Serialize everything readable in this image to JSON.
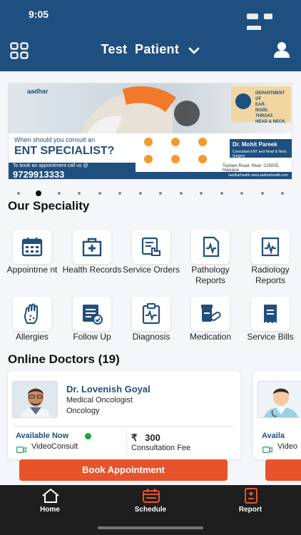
{
  "status_bar": {
    "time": "9:05"
  },
  "header": {
    "patient_name": "Test  Patient"
  },
  "banner": {
    "brand": "aadhar",
    "question": "When should you consult an",
    "title": "ENT SPECIALIST?",
    "call_note": "To book an appointment call us @",
    "phone": "9729913333",
    "department": "DEPARTMENT OF\nEAR.\nNOSE.\nTHROAT.\nHEAD & NECK.",
    "doctor_name": "Dr. Mohit Pareek",
    "doctor_sub": "Consultant ENT and Head & Neck Surgery",
    "address": "Tosham Road, Hisar -125005, Haryana",
    "footer": "/aadharhealth  www.aadharhealth.com"
  },
  "carousel": {
    "count": 14,
    "active_index": 1
  },
  "speciality": {
    "title": "Our Speciality",
    "items": [
      {
        "label": "Appointme nt",
        "icon": "calendar-icon"
      },
      {
        "label": "Health Records",
        "icon": "medical-records-icon"
      },
      {
        "label": "Service Orders",
        "icon": "service-order-icon"
      },
      {
        "label": "Pathology Reports",
        "icon": "pathology-report-icon"
      },
      {
        "label": "Radiology Reports",
        "icon": "radiology-report-icon"
      },
      {
        "label": "Allergies",
        "icon": "allergy-hand-icon"
      },
      {
        "label": "Follow Up",
        "icon": "follow-up-icon"
      },
      {
        "label": "Diagnosis",
        "icon": "diagnosis-clipboard-icon"
      },
      {
        "label": "Medication",
        "icon": "medication-icon"
      },
      {
        "label": "Service Bills",
        "icon": "bill-receipt-icon"
      }
    ]
  },
  "online_doctors": {
    "title": "Online Doctors (19)",
    "doctor": {
      "name": "Dr. Lovenish Goyal",
      "specialty": "Medical Oncologist",
      "department": "Oncology",
      "availability": "Available Now",
      "mode": "VideoConsult",
      "currency": "₹",
      "fee": "300",
      "fee_label": "Consultation Fee"
    },
    "next_card": {
      "availability": "Availa",
      "mode": "Video"
    }
  },
  "book_button": "Book Appointment",
  "bottom_nav": {
    "home": "Home",
    "schedule": "Schedule",
    "report": "Report"
  },
  "colors": {
    "primary": "#1f4f7e",
    "accent": "#e8532b",
    "nav_bg": "#1e1e1e",
    "available": "#1fa33a"
  }
}
